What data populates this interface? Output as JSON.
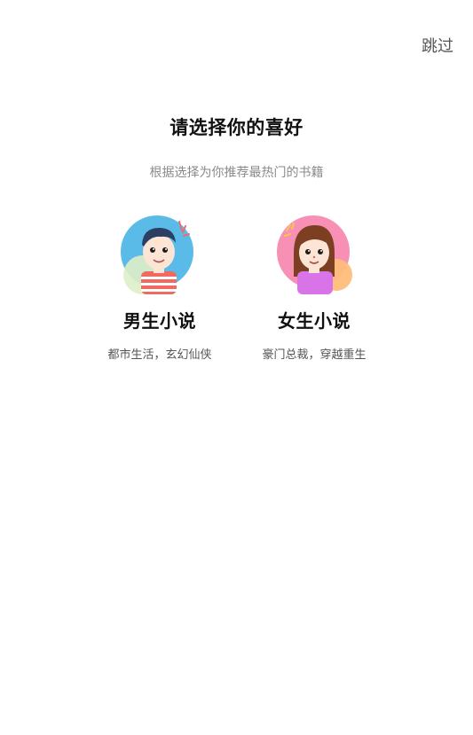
{
  "header": {
    "skip_label": "跳过"
  },
  "main": {
    "title": "请选择你的喜好",
    "subtitle": "根据选择为你推荐最热门的书籍",
    "options": [
      {
        "title": "男生小说",
        "description": "都市生活，玄幻仙侠",
        "avatar_icon": "boy-avatar-icon"
      },
      {
        "title": "女生小说",
        "description": "豪门总裁，穿越重生",
        "avatar_icon": "girl-avatar-icon"
      }
    ]
  },
  "colors": {
    "boy_avatar_bg": "#5bbbe8",
    "girl_avatar_bg": "#f790b4",
    "girl_shirt": "#d874e8",
    "boy_shirt": "#f06a62"
  }
}
